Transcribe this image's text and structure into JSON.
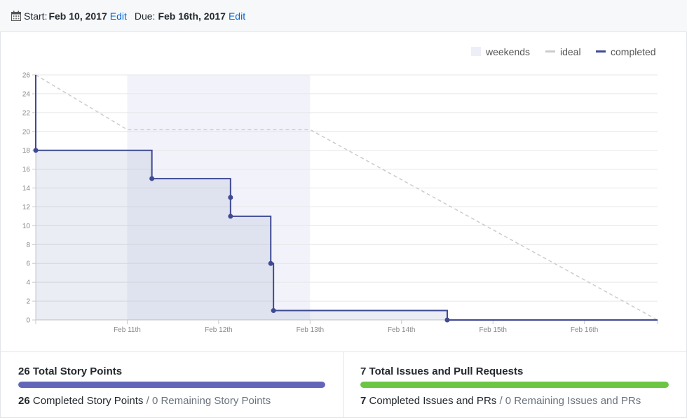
{
  "header": {
    "start_label": "Start:",
    "start_date": "Feb 10, 2017",
    "start_edit": "Edit",
    "due_label": "Due:",
    "due_date": "Feb 16th, 2017",
    "due_edit": "Edit",
    "calendar_icon": "calendar-icon"
  },
  "chart_data": {
    "type": "line",
    "title": "",
    "xlabel": "",
    "ylabel": "",
    "ylim": [
      0,
      26
    ],
    "yticks": [
      "0",
      "2",
      "4",
      "6",
      "8",
      "10",
      "12",
      "14",
      "16",
      "18",
      "20",
      "22",
      "24",
      "26"
    ],
    "xlim_days": [
      10,
      16.8
    ],
    "xticks": [
      {
        "label": "Feb 11th",
        "day": 11
      },
      {
        "label": "Feb 12th",
        "day": 12
      },
      {
        "label": "Feb 13th",
        "day": 13
      },
      {
        "label": "Feb 14th",
        "day": 14
      },
      {
        "label": "Feb 15th",
        "day": 15
      },
      {
        "label": "Feb 16th",
        "day": 16
      }
    ],
    "grid": true,
    "legend_position": "top-right",
    "legend": [
      {
        "name": "weekends",
        "color": "#eceef8"
      },
      {
        "name": "ideal",
        "color": "#cccccc"
      },
      {
        "name": "completed",
        "color": "#3f4a93"
      }
    ],
    "weekends": [
      [
        11,
        13
      ]
    ],
    "series": [
      {
        "name": "ideal",
        "color": "#cccccc",
        "points": [
          [
            10,
            26
          ],
          [
            11,
            20.2
          ],
          [
            13,
            20.2
          ],
          [
            16.8,
            0
          ]
        ]
      },
      {
        "name": "completed",
        "color": "#3f4a93",
        "points": [
          [
            10,
            26
          ],
          [
            10,
            18
          ],
          [
            11.27,
            18
          ],
          [
            11.27,
            15
          ],
          [
            12.13,
            15
          ],
          [
            12.13,
            13
          ],
          [
            12.13,
            11
          ],
          [
            12.57,
            11
          ],
          [
            12.57,
            6
          ],
          [
            12.6,
            6
          ],
          [
            12.6,
            1
          ],
          [
            14.5,
            1
          ],
          [
            14.5,
            0
          ],
          [
            16.8,
            0
          ]
        ],
        "markers": [
          [
            10,
            18
          ],
          [
            11.27,
            15
          ],
          [
            12.13,
            13
          ],
          [
            12.13,
            11
          ],
          [
            12.57,
            6
          ],
          [
            12.6,
            1
          ],
          [
            14.5,
            0
          ]
        ]
      }
    ]
  },
  "stats": {
    "story_points": {
      "total_value": "26",
      "total_label": "Total Story Points",
      "completed_value": "26",
      "completed_label": "Completed Story Points",
      "separator": "/",
      "remaining_text": "0 Remaining Story Points",
      "progress": 1.0,
      "color": "#6366b8"
    },
    "issues": {
      "total_value": "7",
      "total_label": "Total Issues and Pull Requests",
      "completed_value": "7",
      "completed_label": "Completed Issues and PRs",
      "separator": "/",
      "remaining_text": "0 Remaining Issues and PRs",
      "progress": 1.0,
      "color": "#6cc644"
    }
  }
}
